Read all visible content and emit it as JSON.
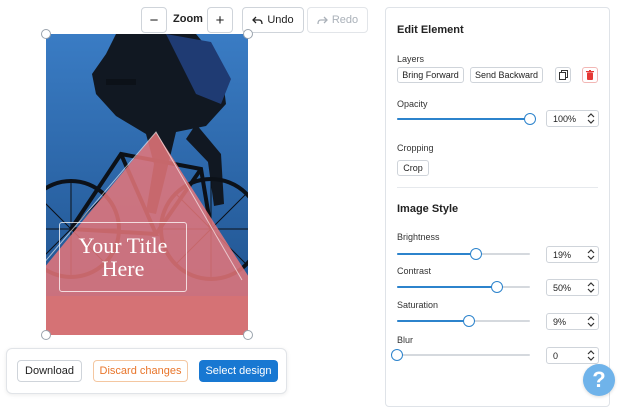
{
  "toolbar": {
    "zoom_out_glyph": "−",
    "zoom_label": "Zoom",
    "zoom_in_glyph": "+",
    "undo_label": "Undo",
    "redo_label": "Redo"
  },
  "canvas": {
    "overlay_title": "Your Title Here",
    "overlay_color": "#e8777a"
  },
  "actions": {
    "download": "Download",
    "discard": "Discard changes",
    "select_design": "Select design"
  },
  "panel": {
    "title": "Edit Element",
    "layers": {
      "label": "Layers",
      "bring_forward": "Bring Forward",
      "send_backward": "Send Backward",
      "duplicate_icon": "copy-icon",
      "delete_icon": "trash-icon"
    },
    "opacity": {
      "label": "Opacity",
      "value": 100,
      "display": "100%"
    },
    "cropping": {
      "label": "Cropping",
      "button": "Crop"
    },
    "image_style": {
      "title": "Image Style",
      "brightness": {
        "label": "Brightness",
        "value": 19,
        "display": "19%"
      },
      "contrast": {
        "label": "Contrast",
        "value": 50,
        "display": "50%"
      },
      "saturation": {
        "label": "Saturation",
        "value": 9,
        "display": "9%"
      },
      "blur": {
        "label": "Blur",
        "value": 0,
        "display": "0"
      }
    }
  },
  "help": {
    "glyph": "?"
  },
  "colors": {
    "accent": "#1878d2",
    "slider": "#2c83cc",
    "discard": "#e8752a",
    "delete": "#e53935",
    "help": "#6fb3ea"
  }
}
